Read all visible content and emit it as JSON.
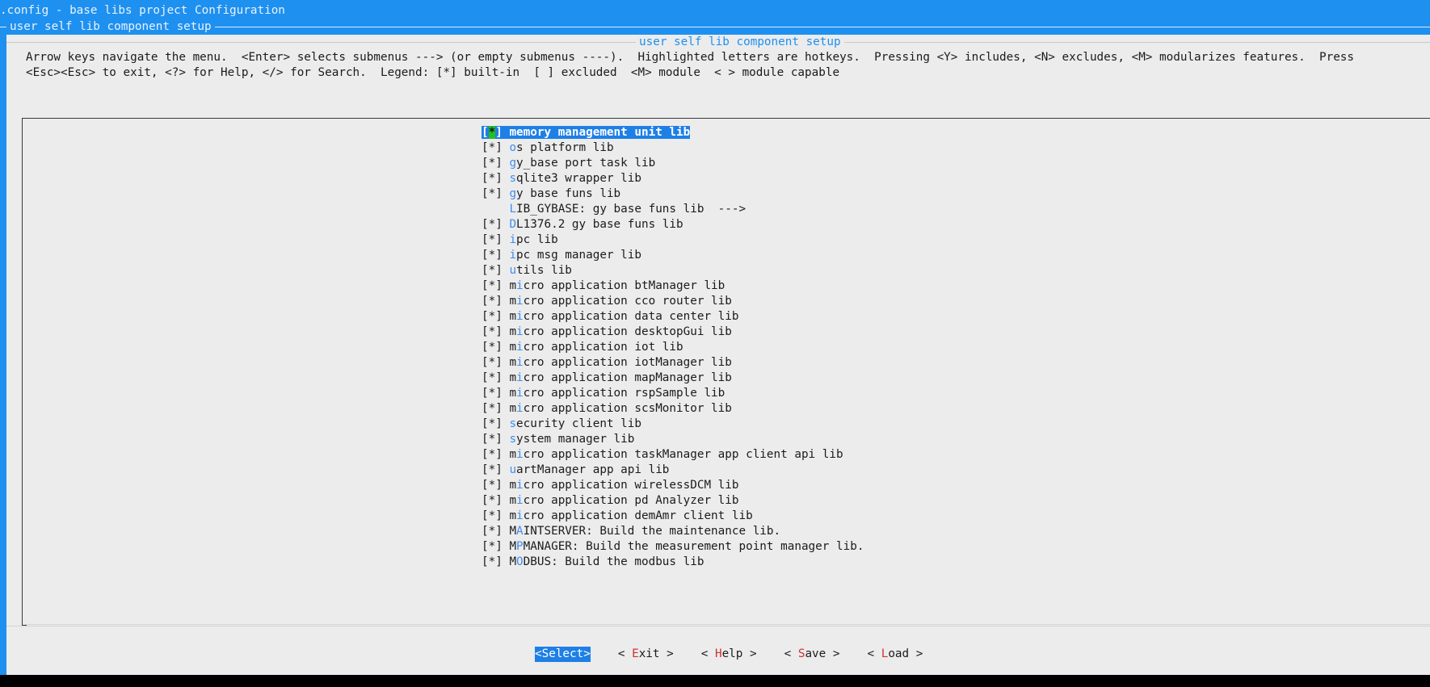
{
  "window": {
    "title": ".config - base libs project Configuration",
    "subtitle": "user self lib component setup"
  },
  "dialog": {
    "title": "user self lib component setup",
    "help_line1": "Arrow keys navigate the menu.  <Enter> selects submenus ---> (or empty submenus ----).  Highlighted letters are hotkeys.  Pressing <Y> includes, <N> excludes, <M> modularizes features.  Press",
    "help_line2": "<Esc><Esc> to exit, <?> for Help, </> for Search.  Legend: [*] built-in  [ ] excluded  <M> module  < > module capable"
  },
  "menu": {
    "items": [
      {
        "prefix": "[*] ",
        "pre": "",
        "hot": "m",
        "rest": "emory management unit lib",
        "selected": true
      },
      {
        "prefix": "[*] ",
        "pre": "",
        "hot": "o",
        "rest": "s platform lib"
      },
      {
        "prefix": "[*] ",
        "pre": "",
        "hot": "g",
        "rest": "y_base port task lib"
      },
      {
        "prefix": "[*] ",
        "pre": "",
        "hot": "s",
        "rest": "qlite3 wrapper lib"
      },
      {
        "prefix": "[*] ",
        "pre": "",
        "hot": "g",
        "rest": "y base funs lib"
      },
      {
        "prefix": "    ",
        "pre": "",
        "hot": "L",
        "rest": "IB_GYBASE: gy base funs lib  --->"
      },
      {
        "prefix": "[*] ",
        "pre": "",
        "hot": "D",
        "rest": "L1376.2 gy base funs lib"
      },
      {
        "prefix": "[*] ",
        "pre": "",
        "hot": "i",
        "rest": "pc lib"
      },
      {
        "prefix": "[*] ",
        "pre": "",
        "hot": "i",
        "rest": "pc msg manager lib"
      },
      {
        "prefix": "[*] ",
        "pre": "",
        "hot": "u",
        "rest": "tils lib"
      },
      {
        "prefix": "[*] ",
        "pre": "m",
        "hot": "i",
        "rest": "cro application btManager lib"
      },
      {
        "prefix": "[*] ",
        "pre": "m",
        "hot": "i",
        "rest": "cro application cco router lib"
      },
      {
        "prefix": "[*] ",
        "pre": "m",
        "hot": "i",
        "rest": "cro application data center lib"
      },
      {
        "prefix": "[*] ",
        "pre": "m",
        "hot": "i",
        "rest": "cro application desktopGui lib"
      },
      {
        "prefix": "[*] ",
        "pre": "m",
        "hot": "i",
        "rest": "cro application iot lib"
      },
      {
        "prefix": "[*] ",
        "pre": "m",
        "hot": "i",
        "rest": "cro application iotManager lib"
      },
      {
        "prefix": "[*] ",
        "pre": "m",
        "hot": "i",
        "rest": "cro application mapManager lib"
      },
      {
        "prefix": "[*] ",
        "pre": "m",
        "hot": "i",
        "rest": "cro application rspSample lib"
      },
      {
        "prefix": "[*] ",
        "pre": "m",
        "hot": "i",
        "rest": "cro application scsMonitor lib"
      },
      {
        "prefix": "[*] ",
        "pre": "",
        "hot": "s",
        "rest": "ecurity client lib"
      },
      {
        "prefix": "[*] ",
        "pre": "",
        "hot": "s",
        "rest": "ystem manager lib"
      },
      {
        "prefix": "[*] ",
        "pre": "m",
        "hot": "i",
        "rest": "cro application taskManager app client api lib"
      },
      {
        "prefix": "[*] ",
        "pre": "",
        "hot": "u",
        "rest": "artManager app api lib"
      },
      {
        "prefix": "[*] ",
        "pre": "m",
        "hot": "i",
        "rest": "cro application wirelessDCM lib"
      },
      {
        "prefix": "[*] ",
        "pre": "m",
        "hot": "i",
        "rest": "cro application pd Analyzer lib"
      },
      {
        "prefix": "[*] ",
        "pre": "m",
        "hot": "i",
        "rest": "cro application demAmr client lib"
      },
      {
        "prefix": "[*] ",
        "pre": "M",
        "hot": "A",
        "rest": "INTSERVER: Build the maintenance lib."
      },
      {
        "prefix": "[*] ",
        "pre": "M",
        "hot": "P",
        "rest": "MANAGER: Build the measurement point manager lib."
      },
      {
        "prefix": "[*] ",
        "pre": "M",
        "hot": "O",
        "rest": "DBUS: Build the modbus lib"
      }
    ]
  },
  "buttons": [
    {
      "name": "select-button",
      "pre": "<",
      "hot": "S",
      "rest": "elect>",
      "active": true
    },
    {
      "name": "exit-button",
      "pre": "< ",
      "hot": "E",
      "rest": "xit >"
    },
    {
      "name": "help-button",
      "pre": "< ",
      "hot": "H",
      "rest": "elp >"
    },
    {
      "name": "save-button",
      "pre": "< ",
      "hot": "S",
      "rest": "ave >"
    },
    {
      "name": "load-button",
      "pre": "< ",
      "hot": "L",
      "rest": "oad >"
    }
  ],
  "colors": {
    "accent": "#1e90f0",
    "hotkey": "#3e8ef0",
    "selected_bg": "#1e7fe6",
    "cursor_green": "#20c020",
    "button_hotkey": "#d03030"
  }
}
